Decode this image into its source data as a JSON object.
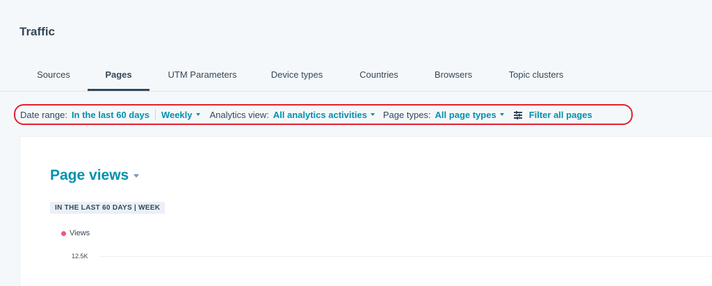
{
  "header": {
    "title": "Traffic"
  },
  "tabs": [
    {
      "label": "Sources",
      "active": false
    },
    {
      "label": "Pages",
      "active": true
    },
    {
      "label": "UTM Parameters",
      "active": false
    },
    {
      "label": "Device types",
      "active": false
    },
    {
      "label": "Countries",
      "active": false
    },
    {
      "label": "Browsers",
      "active": false
    },
    {
      "label": "Topic clusters",
      "active": false
    }
  ],
  "filters": {
    "date_range_label": "Date range:",
    "date_range_value": "In the last 60 days",
    "frequency_value": "Weekly",
    "analytics_view_label": "Analytics view:",
    "analytics_view_value": "All analytics activities",
    "page_types_label": "Page types:",
    "page_types_value": "All page types",
    "filter_all_label": "Filter all pages",
    "filter_icon": "sliders-icon"
  },
  "report": {
    "title": "Page views",
    "range_badge": "IN THE LAST 60 DAYS | WEEK",
    "legend_label": "Views",
    "legend_color": "#f2547d",
    "y_tick": "12.5K"
  },
  "colors": {
    "accent": "#0091ae",
    "text": "#33475b",
    "highlight_outline": "#e0202f"
  }
}
